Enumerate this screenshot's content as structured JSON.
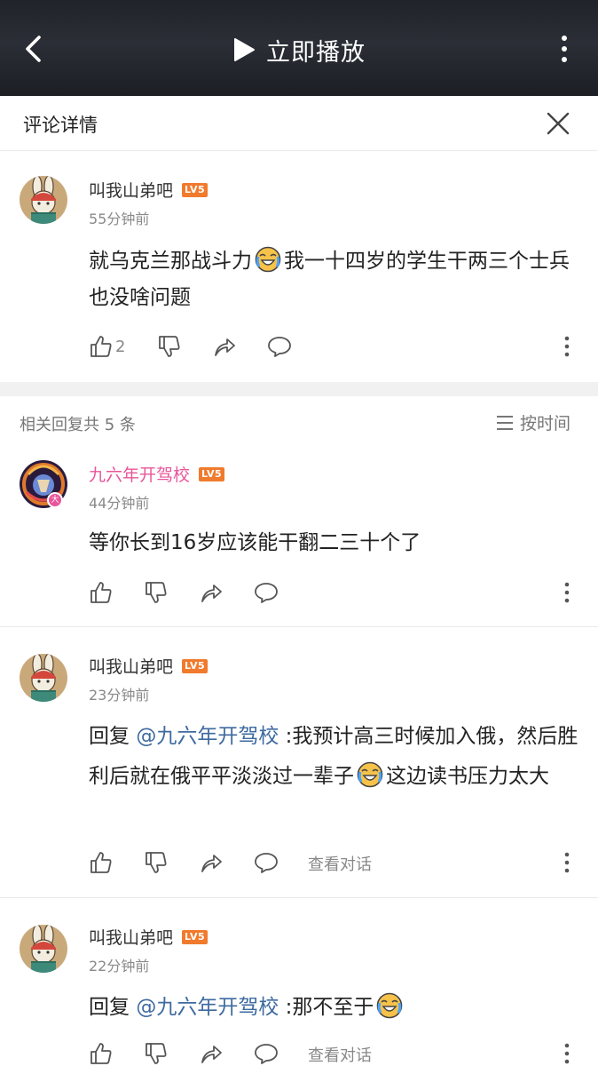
{
  "topbar": {
    "play_label": "立即播放"
  },
  "panel": {
    "title": "评论详情"
  },
  "main_comment": {
    "username": "叫我山弟吧",
    "level": "LV5",
    "time": "55分钟前",
    "text_part1": "就乌克兰那战斗力",
    "text_part2": "我一十四岁的学生干两三个士兵也没啥问题",
    "like_count": "2"
  },
  "replies_header": {
    "count_label": "相关回复共 5 条",
    "sort_label": "按时间"
  },
  "replies": [
    {
      "username": "九六年开驾校",
      "level": "LV5",
      "badge": "大",
      "time": "44分钟前",
      "text": "等你长到16岁应该能干翻二三十个了"
    },
    {
      "username": "叫我山弟吧",
      "level": "LV5",
      "time": "23分钟前",
      "reply_prefix": "回复",
      "mention": "@九六年开驾校",
      "text_part1": ":我预计高三时候加入俄，然后胜利后就在俄平平淡淡过一辈子",
      "text_part2": "这边读书压力太大",
      "view_conversation": "查看对话"
    },
    {
      "username": "叫我山弟吧",
      "level": "LV5",
      "time": "22分钟前",
      "reply_prefix": "回复",
      "mention": "@九六年开驾校",
      "text_part1": ":那不至于",
      "view_conversation": "查看对话"
    }
  ],
  "colors": {
    "level_badge": "#f07b2d",
    "mention": "#3e6aa0",
    "vip_name": "#e8569a",
    "separator": "#f1f1f1"
  },
  "icons": [
    "back-arrow-icon",
    "play-icon",
    "more-vertical-icon",
    "close-icon",
    "thumbs-up-icon",
    "thumbs-down-icon",
    "share-icon",
    "comment-icon",
    "sort-list-icon",
    "crying-laughing-emoji"
  ]
}
